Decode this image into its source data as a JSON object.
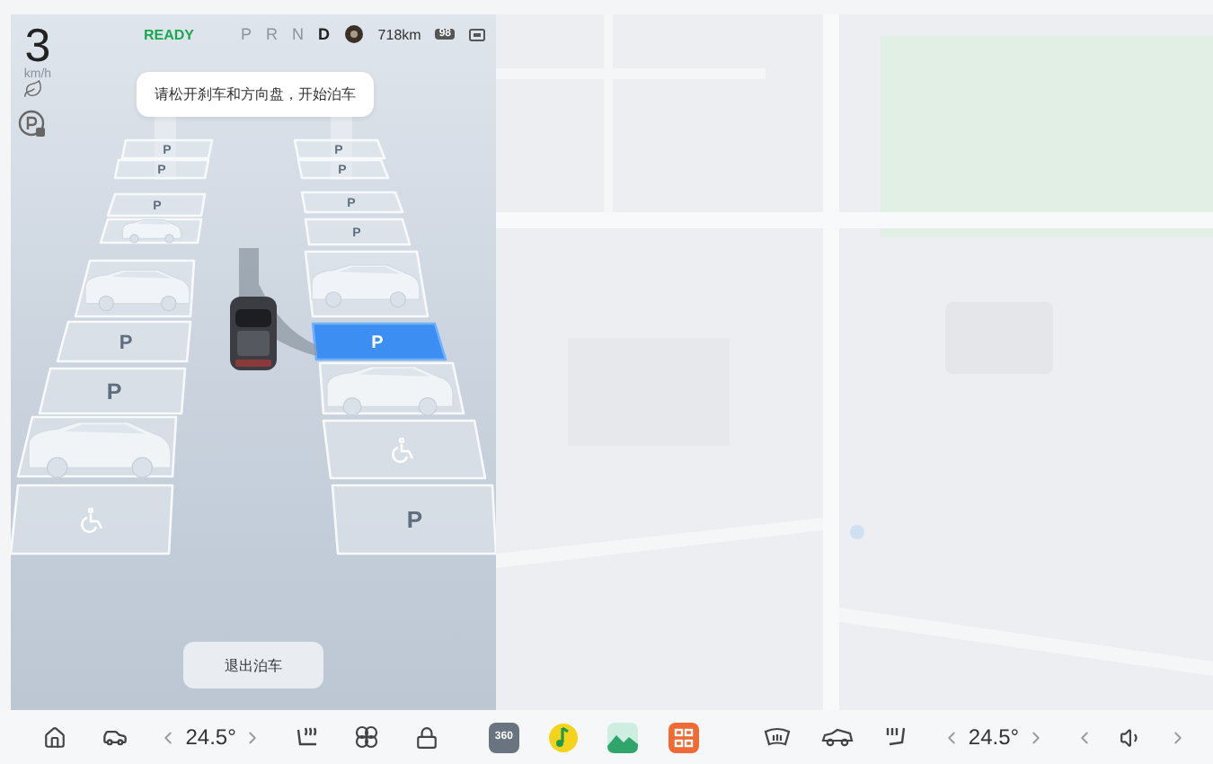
{
  "status": {
    "speed": "3",
    "speed_unit": "km/h",
    "ready": "READY",
    "gears": [
      {
        "label": "P",
        "selected": false
      },
      {
        "label": "R",
        "selected": false
      },
      {
        "label": "N",
        "selected": false
      },
      {
        "label": "D",
        "selected": true
      }
    ],
    "range": "718km",
    "battery": "98"
  },
  "toast": "请松开刹车和方向盘，开始泊车",
  "parking": {
    "left_slots": [
      {
        "kind": "parking",
        "label": "P",
        "selected": false
      },
      {
        "kind": "parking",
        "label": "P",
        "selected": false
      },
      {
        "kind": "parking",
        "label": "P",
        "selected": false
      },
      {
        "kind": "occupied",
        "selected": false
      },
      {
        "kind": "occupied",
        "selected": false
      },
      {
        "kind": "parking",
        "label": "P",
        "selected": false
      },
      {
        "kind": "parking",
        "label": "P",
        "selected": false
      },
      {
        "kind": "occupied",
        "selected": false
      },
      {
        "kind": "accessible",
        "selected": false
      }
    ],
    "right_slots": [
      {
        "kind": "parking",
        "label": "P",
        "selected": false
      },
      {
        "kind": "parking",
        "label": "P",
        "selected": false
      },
      {
        "kind": "parking",
        "label": "P",
        "selected": false
      },
      {
        "kind": "parking",
        "label": "P",
        "selected": false
      },
      {
        "kind": "occupied",
        "selected": false
      },
      {
        "kind": "parking",
        "label": "P",
        "selected": true
      },
      {
        "kind": "occupied",
        "selected": false
      },
      {
        "kind": "accessible",
        "selected": false
      },
      {
        "kind": "parking",
        "label": "P",
        "selected": false
      }
    ]
  },
  "exit_button": "退出泊车",
  "dock": {
    "left_temp": "24.5°",
    "apps": [
      {
        "kind": "camera360",
        "label": "360"
      },
      {
        "kind": "music"
      },
      {
        "kind": "gallery"
      },
      {
        "kind": "grid"
      }
    ],
    "right_temp": "24.5°"
  }
}
